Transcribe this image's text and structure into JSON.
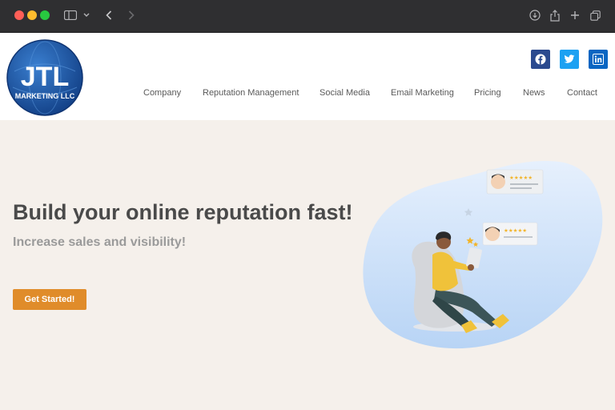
{
  "brand": {
    "logo_main": "JTL",
    "logo_sub": "MARKETING LLC",
    "primary_color": "#1f5fb0",
    "accent_color": "#e08c2a"
  },
  "browser": {
    "icons": [
      "sidebar-icon",
      "chevron-down-icon",
      "back-icon",
      "forward-icon",
      "download-icon",
      "share-icon",
      "new-tab-icon",
      "tabs-overview-icon"
    ]
  },
  "social": [
    {
      "name": "facebook",
      "glyph": "f",
      "color": "#3b5998"
    },
    {
      "name": "twitter",
      "glyph": "t",
      "color": "#1da1f2"
    },
    {
      "name": "linkedin",
      "glyph": "in",
      "color": "#0a66c2"
    }
  ],
  "nav": {
    "items": [
      "Company",
      "Reputation Management",
      "Social Media",
      "Email Marketing",
      "Pricing",
      "News",
      "Contact"
    ]
  },
  "hero": {
    "title": "Build your online reputation fast!",
    "subtitle": "Increase sales and visibility!",
    "cta_label": "Get Started!"
  },
  "illustration": {
    "review_card_1_stars": "★★★★★",
    "review_card_2_stars": "★★★★★"
  }
}
